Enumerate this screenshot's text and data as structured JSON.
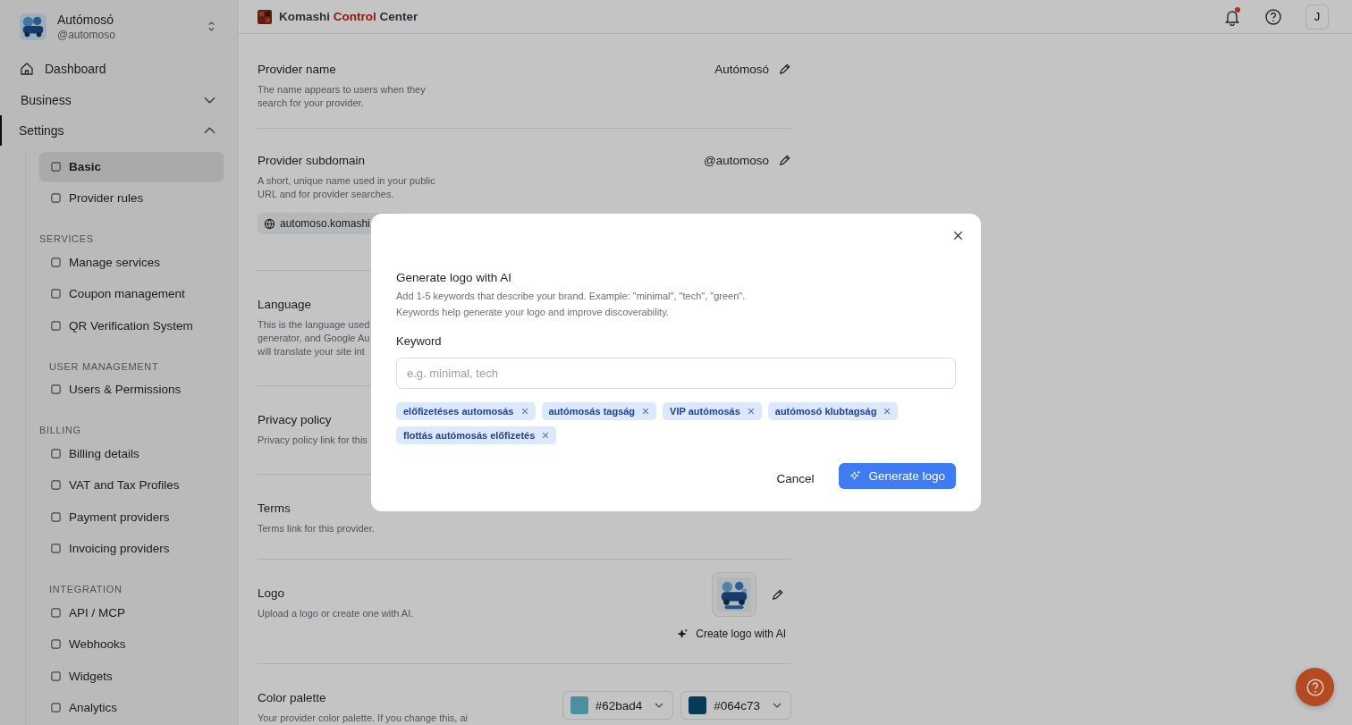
{
  "account": {
    "name": "Autómosó",
    "handle": "@automoso"
  },
  "nav": [
    {
      "kind": "link",
      "label": "Dashboard"
    },
    {
      "kind": "group",
      "label": "Business",
      "expanded": false,
      "selected": false
    },
    {
      "kind": "group",
      "label": "Settings",
      "expanded": true,
      "selected": true
    }
  ],
  "settings_items": [
    {
      "kind": "item",
      "label": "Basic",
      "selected": true
    },
    {
      "kind": "item",
      "label": "Provider rules",
      "selected": false
    },
    {
      "kind": "heading",
      "label": "SERVICES"
    },
    {
      "kind": "item",
      "label": "Manage services",
      "selected": false
    },
    {
      "kind": "item",
      "label": "Coupon management",
      "selected": false
    },
    {
      "kind": "item",
      "label": "QR Verification System",
      "selected": false
    },
    {
      "kind": "heading",
      "label": "USER MANAGEMENT"
    },
    {
      "kind": "item",
      "label": "Users & Permissions",
      "selected": false
    },
    {
      "kind": "heading",
      "label": "BILLING"
    },
    {
      "kind": "item",
      "label": "Billing details",
      "selected": false
    },
    {
      "kind": "item",
      "label": "VAT and Tax Profiles",
      "selected": false
    },
    {
      "kind": "item",
      "label": "Payment providers",
      "selected": false
    },
    {
      "kind": "item",
      "label": "Invoicing providers",
      "selected": false
    },
    {
      "kind": "heading",
      "label": "INTEGRATION"
    },
    {
      "kind": "item",
      "label": "API / MCP",
      "selected": false
    },
    {
      "kind": "item",
      "label": "Webhooks",
      "selected": false
    },
    {
      "kind": "item",
      "label": "Widgets",
      "selected": false
    },
    {
      "kind": "item",
      "label": "Analytics",
      "selected": false
    }
  ],
  "header": {
    "brand": "Komashi",
    "brand_highlight": "Control",
    "brand_suffix": "Center",
    "unread_notifications": true,
    "avatar": "J"
  },
  "sections": [
    {
      "kind": "value",
      "title": "Provider name",
      "description": [
        "The name appears to users when they",
        "search for your provider."
      ],
      "value": "Autómosó"
    },
    {
      "kind": "subdomain",
      "title": "Provider subdomain",
      "description": [
        "A short, unique name used in your public",
        "URL and for provider searches."
      ],
      "value": "@automoso",
      "url": "automoso.komashi"
    },
    {
      "kind": "plain",
      "title": "Language",
      "description": [
        "This is the language used",
        "generator, and Google Au",
        "will translate your site int"
      ]
    },
    {
      "kind": "plain",
      "title": "Privacy policy",
      "description": [
        "Privacy policy link for this"
      ]
    },
    {
      "kind": "plain",
      "title": "Terms",
      "description": [
        "Terms link for this provider."
      ]
    },
    {
      "kind": "logo",
      "title": "Logo",
      "description": [
        "Upload a logo or create one with AI."
      ],
      "action": "Create logo with AI"
    },
    {
      "kind": "palette",
      "title": "Color palette",
      "description": [
        "Your provider color palette. If you change this, ai"
      ],
      "swatches": [
        {
          "label": "#62bad4",
          "color": "#4b8fa3"
        },
        {
          "label": "#064c73",
          "color": "#053a59"
        }
      ]
    }
  ],
  "modal": {
    "title": "Generate logo with AI",
    "description": [
      "Add 1-5 keywords that describe your brand. Example: \"minimal\", \"tech\", \"green\".",
      "Keywords help generate your logo and improve discoverability."
    ],
    "field_label": "Keyword",
    "placeholder": "e.g. minimal, tech",
    "keywords": [
      "előfizetéses automosás",
      "autómosás tagság",
      "VIP autómosás",
      "autómosó klubtagság",
      "flottás autómosás előfizetés"
    ],
    "cancel": "Cancel",
    "submit": "Generate logo"
  }
}
